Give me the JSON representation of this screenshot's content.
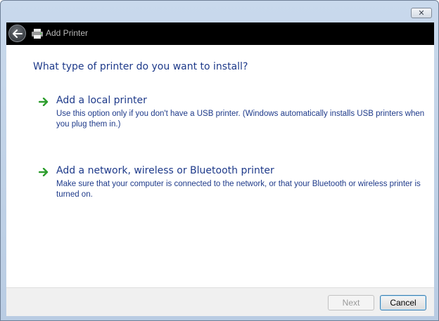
{
  "window": {
    "title": "Add Printer",
    "close_label": "✕"
  },
  "header": {
    "title": "Add Printer"
  },
  "main": {
    "question": "What type of printer do you want to install?",
    "options": [
      {
        "title": "Add a local printer",
        "description": "Use this option only if you don't have a USB printer. (Windows automatically installs USB printers when you plug them in.)"
      },
      {
        "title": "Add a network, wireless or Bluetooth printer",
        "description": "Make sure that your computer is connected to the network, or that your Bluetooth or wireless printer is turned on."
      }
    ]
  },
  "footer": {
    "next_label": "Next",
    "cancel_label": "Cancel",
    "next_enabled": false
  },
  "icons": {
    "back": "back-arrow-icon",
    "printer": "printer-icon",
    "option_arrow": "green-arrow-icon"
  },
  "colors": {
    "accent_text": "#1e3a8a",
    "arrow_green": "#2e9e2e",
    "header_bg": "#000000"
  }
}
